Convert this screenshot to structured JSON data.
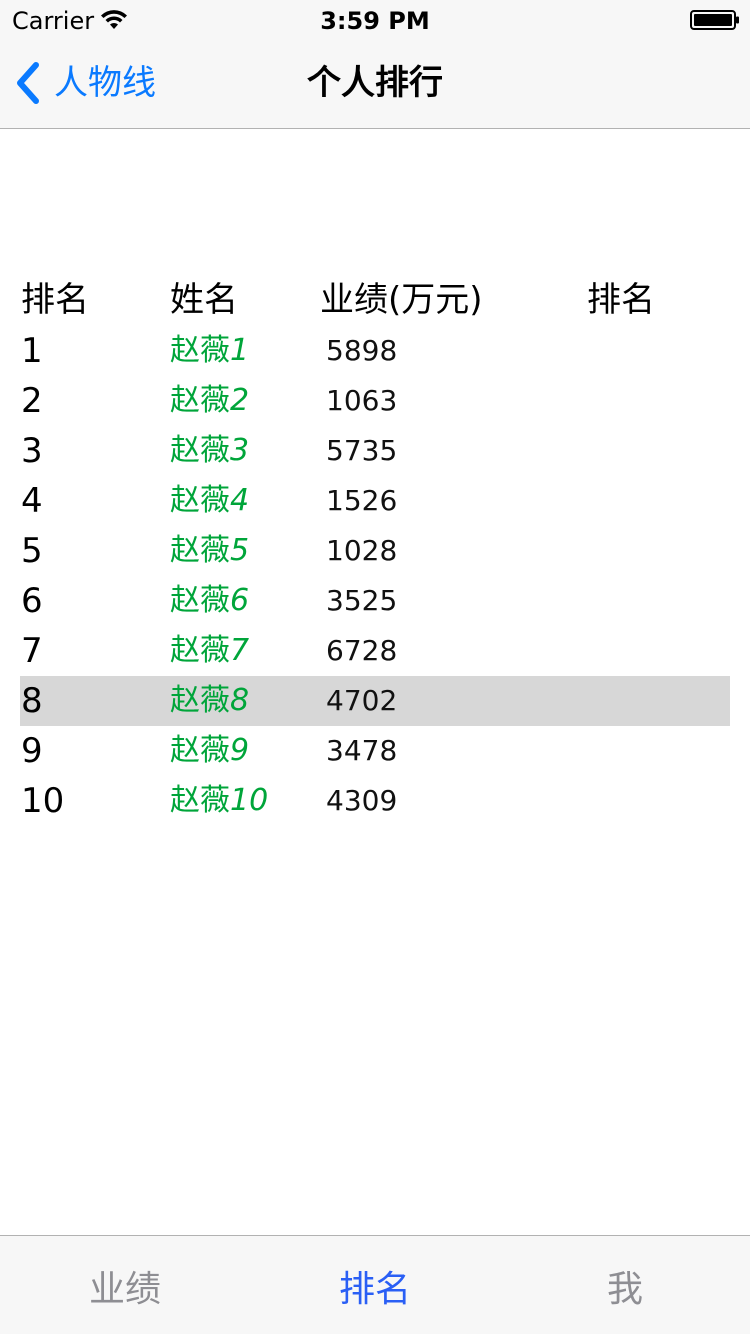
{
  "status_bar": {
    "carrier": "Carrier",
    "time": "3:59 PM"
  },
  "nav": {
    "back_label": "人物线",
    "title": "个人排行"
  },
  "table": {
    "headers": [
      "排名",
      "姓名",
      "业绩(万元)",
      "排名"
    ],
    "rows": [
      {
        "rank": "1",
        "name_prefix": "赵薇",
        "name_num": "1",
        "perf": "5898"
      },
      {
        "rank": "2",
        "name_prefix": "赵薇",
        "name_num": "2",
        "perf": "1063"
      },
      {
        "rank": "3",
        "name_prefix": "赵薇",
        "name_num": "3",
        "perf": "5735"
      },
      {
        "rank": "4",
        "name_prefix": "赵薇",
        "name_num": "4",
        "perf": "1526"
      },
      {
        "rank": "5",
        "name_prefix": "赵薇",
        "name_num": "5",
        "perf": "1028"
      },
      {
        "rank": "6",
        "name_prefix": "赵薇",
        "name_num": "6",
        "perf": "3525"
      },
      {
        "rank": "7",
        "name_prefix": "赵薇",
        "name_num": "7",
        "perf": "6728"
      },
      {
        "rank": "8",
        "name_prefix": "赵薇",
        "name_num": "8",
        "perf": "4702"
      },
      {
        "rank": "9",
        "name_prefix": "赵薇",
        "name_num": "9",
        "perf": "3478"
      },
      {
        "rank": "10",
        "name_prefix": "赵薇",
        "name_num": "10",
        "perf": "4309"
      }
    ],
    "selected_row": 7
  },
  "tabs": [
    {
      "label": "业绩"
    },
    {
      "label": "排名"
    },
    {
      "label": "我"
    }
  ],
  "colors": {
    "accent": "#0a7aff",
    "name_green": "#00a53a",
    "tab_active": "#2a5ff5",
    "tab_inactive": "#8e8e93",
    "selected_row_bg": "#d7d7d7"
  }
}
